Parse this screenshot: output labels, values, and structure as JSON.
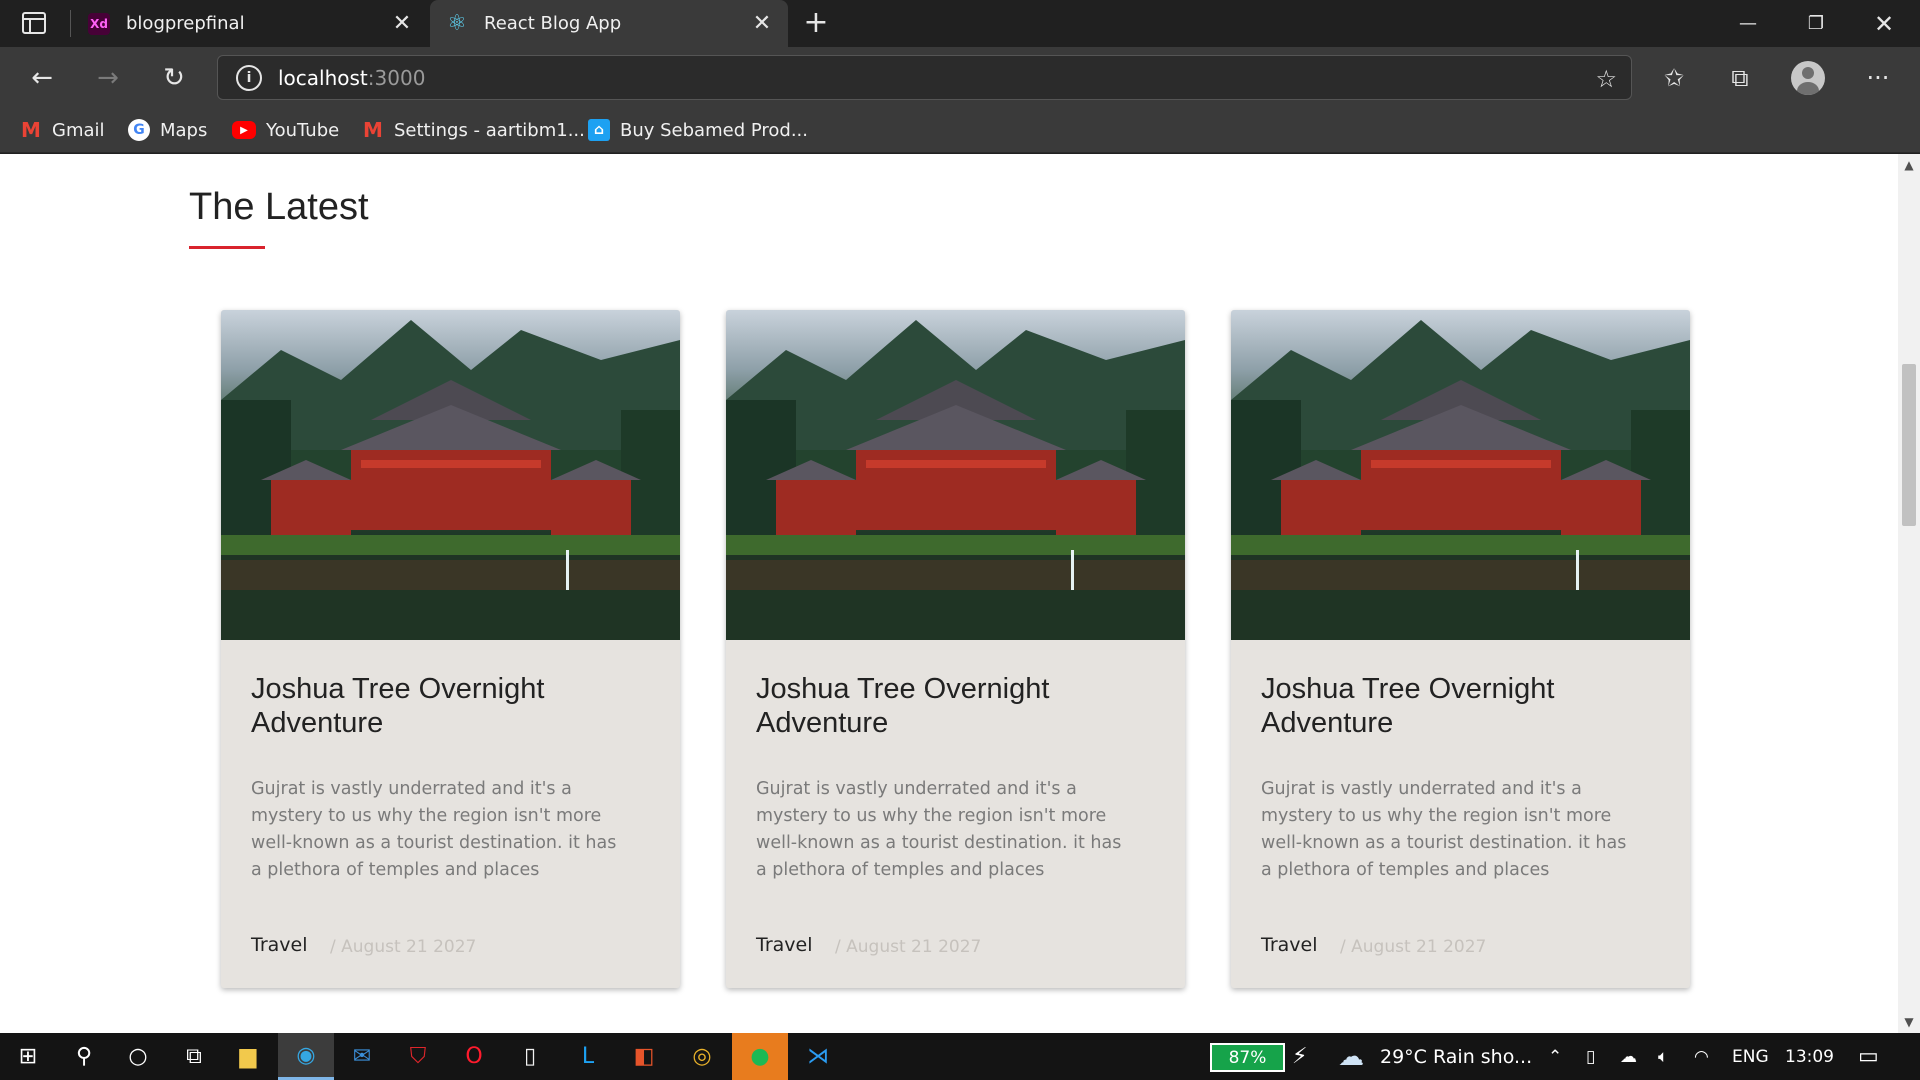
{
  "browser": {
    "tabs": [
      {
        "title": "blogprepfinal",
        "favicon": "Xd"
      },
      {
        "title": "React Blog App",
        "favicon": "react-icon"
      }
    ],
    "address": {
      "host": "localhost",
      "port": ":3000"
    },
    "bookmarks": [
      {
        "label": "Gmail",
        "icon": "gmail-icon"
      },
      {
        "label": "Maps",
        "icon": "google-icon"
      },
      {
        "label": "YouTube",
        "icon": "youtube-icon"
      },
      {
        "label": "Settings - aartibm1...",
        "icon": "gmail-icon"
      },
      {
        "label": "Buy Sebamed Prod...",
        "icon": "shop-icon"
      }
    ]
  },
  "page": {
    "section_title": "The Latest",
    "accent_color": "#d9232d",
    "cards": [
      {
        "title": "Joshua Tree Overnight Adventure",
        "text": "Gujrat is vastly underrated and it's a mystery to us why the region isn't more well-known as a tourist destination. it has a plethora of temples and places",
        "category": "Travel",
        "date": "/ August 21 2027"
      },
      {
        "title": "Joshua Tree Overnight Adventure",
        "text": "Gujrat is vastly underrated and it's a mystery to us why the region isn't more well-known as a tourist destination. it has a plethora of temples and places",
        "category": "Travel",
        "date": "/ August 21 2027"
      },
      {
        "title": "Joshua Tree Overnight Adventure",
        "text": "Gujrat is vastly underrated and it's a mystery to us why the region isn't more well-known as a tourist destination. it has a plethora of temples and places",
        "category": "Travel",
        "date": "/ August 21 2027"
      }
    ]
  },
  "taskbar": {
    "battery": "87%",
    "weather": "29°C  Rain sho...",
    "language": "ENG",
    "time": "13:09"
  }
}
